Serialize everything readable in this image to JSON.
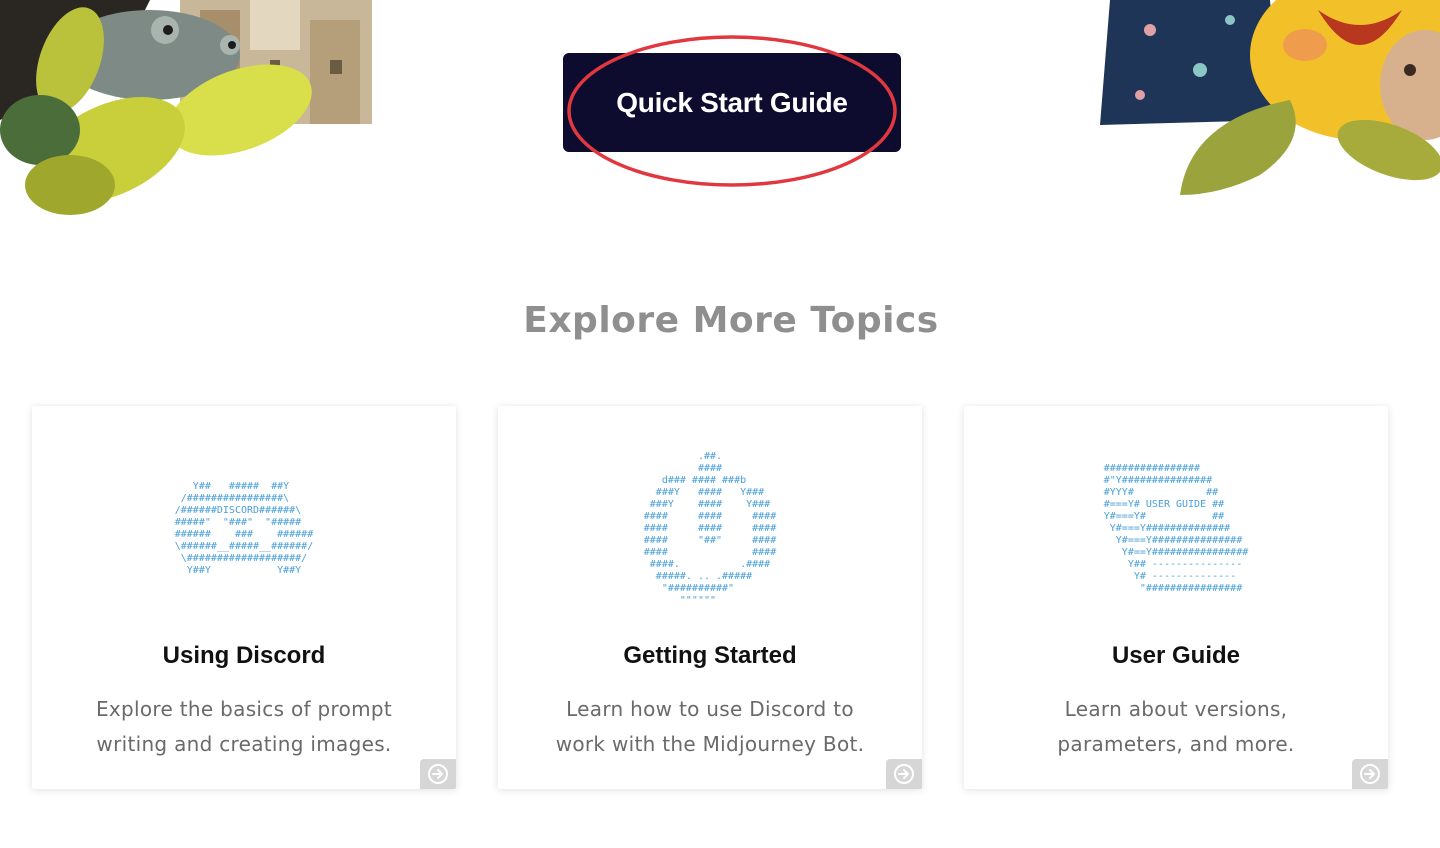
{
  "hero": {
    "quick_start_label": "Quick Start Guide",
    "highlight_color": "#e0383e",
    "button_color": "#0d0b2e"
  },
  "topics": {
    "title": "Explore More Topics",
    "cards": [
      {
        "title": "Using Discord",
        "description": "Explore the basics of prompt writing and creating images.",
        "ascii": "   Y##   #####  ##Y\n /################\\\n/######DISCORD######\\\n#####\"  \"###\"  \"#####\n######    ###    ######\n\\######__#####__######/\n \\###################/\n  Y##Y           Y##Y",
        "icon": "arrow-circle-right-icon"
      },
      {
        "title": "Getting Started",
        "description": "Learn how to use Discord to work with the Midjourney Bot.",
        "ascii": "         .##.\n         ####\n   d### #### ###b\n  ###Y   ####   Y###\n ###Y    ####    Y###\n####     ####     ####\n####     ####     ####\n####     \"##\"     ####\n####              ####\n ####.          .####\n  #####. .. .#####\n   \"##########\"\n      \"\"\"\"\"\"",
        "icon": "arrow-circle-right-icon"
      },
      {
        "title": "User Guide",
        "description": "Learn about versions, parameters, and more.",
        "ascii": "################\n#\"Y###############\n#YYY#            ##\n#===Y# USER GUIDE ##\nY#===Y#           ##\n Y#===Y##############\n  Y#===Y###############\n   Y#==Y################\n    Y## ---------------\n     Y# --------------\n      \"################",
        "icon": "arrow-circle-right-icon"
      }
    ]
  }
}
